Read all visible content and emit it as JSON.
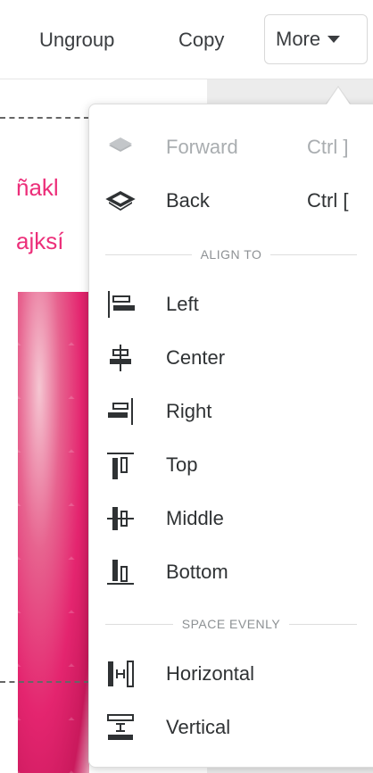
{
  "toolbar": {
    "ungroup_label": "Ungroup",
    "copy_label": "Copy",
    "more_label": "More"
  },
  "canvas": {
    "text_line_1": "ñakl",
    "text_line_2": "ajksí"
  },
  "menu": {
    "forward": {
      "label": "Forward",
      "shortcut": "Ctrl ]"
    },
    "back": {
      "label": "Back",
      "shortcut": "Ctrl ["
    },
    "align_to_header": "ALIGN TO",
    "align": {
      "left": "Left",
      "center": "Center",
      "right": "Right",
      "top": "Top",
      "middle": "Middle",
      "bottom": "Bottom"
    },
    "space_evenly_header": "SPACE EVENLY",
    "space": {
      "horizontal": "Horizontal",
      "vertical": "Vertical"
    }
  },
  "colors": {
    "accent_pink": "#ec2f7a",
    "icon_dark": "#2f3234",
    "disabled": "#a9adb0"
  }
}
